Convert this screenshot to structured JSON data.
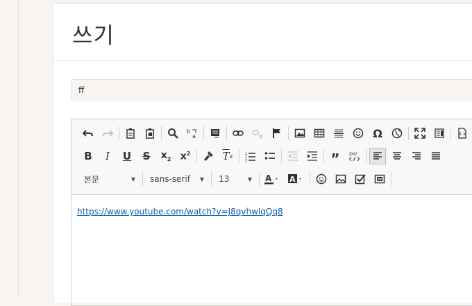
{
  "page_title": "쓰기",
  "subject": {
    "value": "ff"
  },
  "editor": {
    "format_select": "본문",
    "font_select": "sans-serif",
    "size_select": "13",
    "content_link": "https://www.youtube.com/watch?v=J8qvhwlqQq8"
  },
  "colors": {
    "accent_link": "#0b5ea8",
    "toolbar_bg": "#f8f8f8",
    "page_bg": "#f7f4f1"
  },
  "icons": {
    "row1": [
      "undo-icon",
      "redo-icon",
      "paste-icon",
      "paste-text-icon",
      "find-icon",
      "replace-icon",
      "select-all-icon",
      "link-icon",
      "unlink-icon",
      "anchor-icon",
      "image-icon",
      "table-icon",
      "horizontal-rule-icon",
      "emoji-icon",
      "special-char-icon",
      "iframe-icon",
      "maximize-icon",
      "show-blocks-icon",
      "source-icon"
    ],
    "row2": [
      "bold-icon",
      "italic-icon",
      "underline-icon",
      "strikethrough-icon",
      "subscript-icon",
      "superscript-icon",
      "copy-format-icon",
      "remove-format-icon",
      "numbered-list-icon",
      "bulleted-list-icon",
      "outdent-icon",
      "indent-icon",
      "blockquote-icon",
      "create-div-icon",
      "align-left-icon",
      "align-center-icon",
      "align-right-icon",
      "justify-icon"
    ],
    "row3": [
      "text-color-icon",
      "bg-color-icon",
      "emoticon-icon",
      "image2-icon",
      "checkbox-icon",
      "media-icon"
    ]
  }
}
